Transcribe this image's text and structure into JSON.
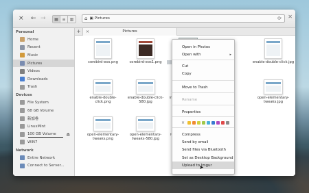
{
  "window": {
    "close_glyph": "×",
    "back_glyph": "←",
    "forward_glyph": "→",
    "refresh_glyph": "⟳",
    "close_right_glyph": "✕",
    "view_icons": [
      "▦",
      "≡",
      "▥"
    ],
    "path": "Pictures",
    "home_glyph": "⌂",
    "folder_glyph": "▣"
  },
  "sidebar": {
    "personal_label": "Personal",
    "personal": [
      {
        "label": "Home",
        "color": "#c9a16a"
      },
      {
        "label": "Recent",
        "color": "#8d96a6"
      },
      {
        "label": "Music",
        "color": "#d29a3c"
      },
      {
        "label": "Pictures",
        "color": "#7a8cb0",
        "selected": true
      },
      {
        "label": "Videos",
        "color": "#7f7f7f"
      },
      {
        "label": "Downloads",
        "color": "#4a7fd0"
      },
      {
        "label": "Trash",
        "color": "#9a9a9a"
      }
    ],
    "devices_label": "Devices",
    "devices": [
      {
        "label": "File System"
      },
      {
        "label": "68 GB Volume"
      },
      {
        "label": "新加卷"
      },
      {
        "label": "LinuxMint"
      },
      {
        "label": "100 GB Volume",
        "eject": "⏏"
      },
      {
        "label": "WIN7"
      }
    ],
    "network_label": "Network",
    "network": [
      {
        "label": "Entire Network"
      },
      {
        "label": "Connect to Server..."
      }
    ]
  },
  "tabs": {
    "plus": "+",
    "tab_close": "×",
    "tab_label": "Pictures"
  },
  "files": [
    {
      "name": "corebird-eos.png"
    },
    {
      "name": "corebird-eos1.png",
      "dark": true
    },
    {
      "name": "corebird-eos2.png"
    },
    {
      "name": ""
    },
    {
      "name": "enable-double-click.jpg"
    },
    {
      "name": "enable-double-click.png"
    },
    {
      "name": "enable-double-click-580.jpg"
    },
    {
      "name": "img-upload-links.png"
    },
    {
      "name": ""
    },
    {
      "name": "open-elementary-tweaks.jpg"
    },
    {
      "name": "open-elementary-tweaks.png"
    },
    {
      "name": "open-elementary-tweaks-580.jpg"
    },
    {
      "name": "reload-channels.png"
    }
  ],
  "context_menu": {
    "items": [
      "Open in Photos",
      "Open with",
      "Cut",
      "Copy",
      "Move to Trash",
      "Rename",
      "Properties",
      "Compress",
      "Send by email",
      "Send files via Bluetooth",
      "Set as Desktop Background",
      "Upload to Imgur"
    ],
    "submenu_arrow": "▸",
    "swatch_clear": "×",
    "swatches": [
      "#f0c030",
      "#f08a30",
      "#d0d040",
      "#a0c84a",
      "#4ab0d8",
      "#3a7ad0",
      "#b04ac0",
      "#e04a4a",
      "#8a8a8a"
    ]
  }
}
